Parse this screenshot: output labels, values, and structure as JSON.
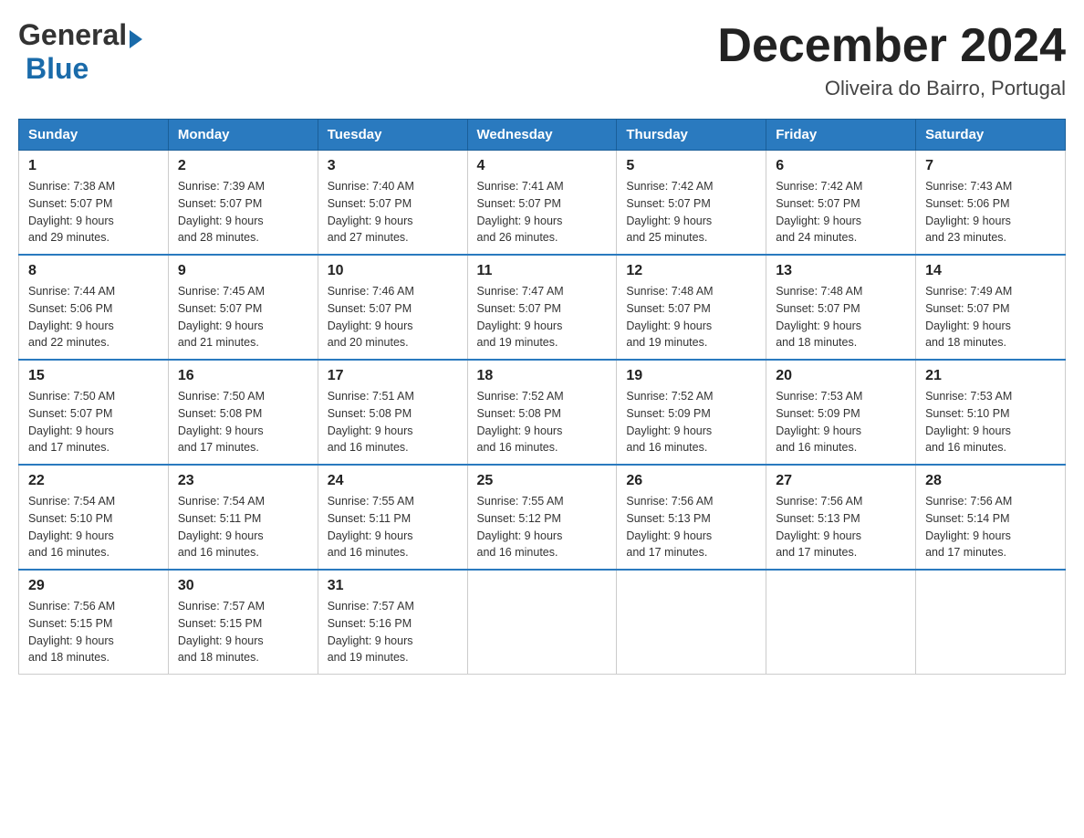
{
  "header": {
    "logo_general": "General",
    "logo_blue": "Blue",
    "month_year": "December 2024",
    "location": "Oliveira do Bairro, Portugal"
  },
  "calendar": {
    "days": [
      "Sunday",
      "Monday",
      "Tuesday",
      "Wednesday",
      "Thursday",
      "Friday",
      "Saturday"
    ],
    "weeks": [
      [
        {
          "day": 1,
          "sunrise": "7:38 AM",
          "sunset": "5:07 PM",
          "daylight": "9 hours and 29 minutes."
        },
        {
          "day": 2,
          "sunrise": "7:39 AM",
          "sunset": "5:07 PM",
          "daylight": "9 hours and 28 minutes."
        },
        {
          "day": 3,
          "sunrise": "7:40 AM",
          "sunset": "5:07 PM",
          "daylight": "9 hours and 27 minutes."
        },
        {
          "day": 4,
          "sunrise": "7:41 AM",
          "sunset": "5:07 PM",
          "daylight": "9 hours and 26 minutes."
        },
        {
          "day": 5,
          "sunrise": "7:42 AM",
          "sunset": "5:07 PM",
          "daylight": "9 hours and 25 minutes."
        },
        {
          "day": 6,
          "sunrise": "7:42 AM",
          "sunset": "5:07 PM",
          "daylight": "9 hours and 24 minutes."
        },
        {
          "day": 7,
          "sunrise": "7:43 AM",
          "sunset": "5:06 PM",
          "daylight": "9 hours and 23 minutes."
        }
      ],
      [
        {
          "day": 8,
          "sunrise": "7:44 AM",
          "sunset": "5:06 PM",
          "daylight": "9 hours and 22 minutes."
        },
        {
          "day": 9,
          "sunrise": "7:45 AM",
          "sunset": "5:07 PM",
          "daylight": "9 hours and 21 minutes."
        },
        {
          "day": 10,
          "sunrise": "7:46 AM",
          "sunset": "5:07 PM",
          "daylight": "9 hours and 20 minutes."
        },
        {
          "day": 11,
          "sunrise": "7:47 AM",
          "sunset": "5:07 PM",
          "daylight": "9 hours and 19 minutes."
        },
        {
          "day": 12,
          "sunrise": "7:48 AM",
          "sunset": "5:07 PM",
          "daylight": "9 hours and 19 minutes."
        },
        {
          "day": 13,
          "sunrise": "7:48 AM",
          "sunset": "5:07 PM",
          "daylight": "9 hours and 18 minutes."
        },
        {
          "day": 14,
          "sunrise": "7:49 AM",
          "sunset": "5:07 PM",
          "daylight": "9 hours and 18 minutes."
        }
      ],
      [
        {
          "day": 15,
          "sunrise": "7:50 AM",
          "sunset": "5:07 PM",
          "daylight": "9 hours and 17 minutes."
        },
        {
          "day": 16,
          "sunrise": "7:50 AM",
          "sunset": "5:08 PM",
          "daylight": "9 hours and 17 minutes."
        },
        {
          "day": 17,
          "sunrise": "7:51 AM",
          "sunset": "5:08 PM",
          "daylight": "9 hours and 16 minutes."
        },
        {
          "day": 18,
          "sunrise": "7:52 AM",
          "sunset": "5:08 PM",
          "daylight": "9 hours and 16 minutes."
        },
        {
          "day": 19,
          "sunrise": "7:52 AM",
          "sunset": "5:09 PM",
          "daylight": "9 hours and 16 minutes."
        },
        {
          "day": 20,
          "sunrise": "7:53 AM",
          "sunset": "5:09 PM",
          "daylight": "9 hours and 16 minutes."
        },
        {
          "day": 21,
          "sunrise": "7:53 AM",
          "sunset": "5:10 PM",
          "daylight": "9 hours and 16 minutes."
        }
      ],
      [
        {
          "day": 22,
          "sunrise": "7:54 AM",
          "sunset": "5:10 PM",
          "daylight": "9 hours and 16 minutes."
        },
        {
          "day": 23,
          "sunrise": "7:54 AM",
          "sunset": "5:11 PM",
          "daylight": "9 hours and 16 minutes."
        },
        {
          "day": 24,
          "sunrise": "7:55 AM",
          "sunset": "5:11 PM",
          "daylight": "9 hours and 16 minutes."
        },
        {
          "day": 25,
          "sunrise": "7:55 AM",
          "sunset": "5:12 PM",
          "daylight": "9 hours and 16 minutes."
        },
        {
          "day": 26,
          "sunrise": "7:56 AM",
          "sunset": "5:13 PM",
          "daylight": "9 hours and 17 minutes."
        },
        {
          "day": 27,
          "sunrise": "7:56 AM",
          "sunset": "5:13 PM",
          "daylight": "9 hours and 17 minutes."
        },
        {
          "day": 28,
          "sunrise": "7:56 AM",
          "sunset": "5:14 PM",
          "daylight": "9 hours and 17 minutes."
        }
      ],
      [
        {
          "day": 29,
          "sunrise": "7:56 AM",
          "sunset": "5:15 PM",
          "daylight": "9 hours and 18 minutes."
        },
        {
          "day": 30,
          "sunrise": "7:57 AM",
          "sunset": "5:15 PM",
          "daylight": "9 hours and 18 minutes."
        },
        {
          "day": 31,
          "sunrise": "7:57 AM",
          "sunset": "5:16 PM",
          "daylight": "9 hours and 19 minutes."
        },
        null,
        null,
        null,
        null
      ]
    ]
  }
}
